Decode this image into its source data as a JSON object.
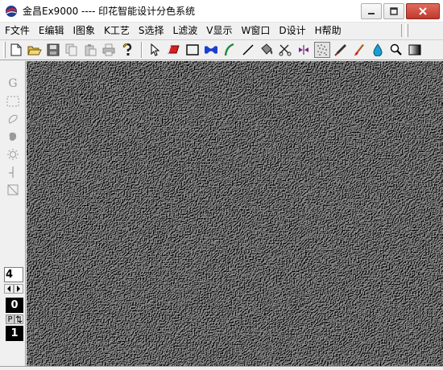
{
  "window": {
    "title": "金昌Ex9000 ---- 印花智能设计分色系统"
  },
  "menu": {
    "items": [
      {
        "label": "F文件"
      },
      {
        "label": "E编辑"
      },
      {
        "label": "I图象"
      },
      {
        "label": "K工艺"
      },
      {
        "label": "S选择"
      },
      {
        "label": "L滤波"
      },
      {
        "label": "V显示"
      },
      {
        "label": "W窗口"
      },
      {
        "label": "D设计"
      },
      {
        "label": "H帮助"
      }
    ]
  },
  "toolbar": {
    "file_tools": [
      "new-file-icon",
      "open-folder-icon",
      "save-icon",
      "copy-icon",
      "paste-icon",
      "print-icon",
      "help-icon"
    ],
    "draw_tools": [
      "select-arrow-icon",
      "eraser-icon",
      "rectangle-icon",
      "mask-icon",
      "curve-icon",
      "line-icon",
      "fill-bucket-icon",
      "scissors-icon",
      "mirror-icon",
      "spray-icon",
      "pen-icon",
      "brush-icon",
      "water-drop-icon",
      "zoom-icon",
      "gradient-icon"
    ]
  },
  "leftpanel": {
    "tool_g": "G",
    "brush_size": "4",
    "color_a": "0",
    "p_label": "P",
    "color_b": "1"
  },
  "colors": {
    "canvas_texture": "#6f6f6f",
    "chrome": "#f0f0f0",
    "close_button": "#c0392b"
  }
}
